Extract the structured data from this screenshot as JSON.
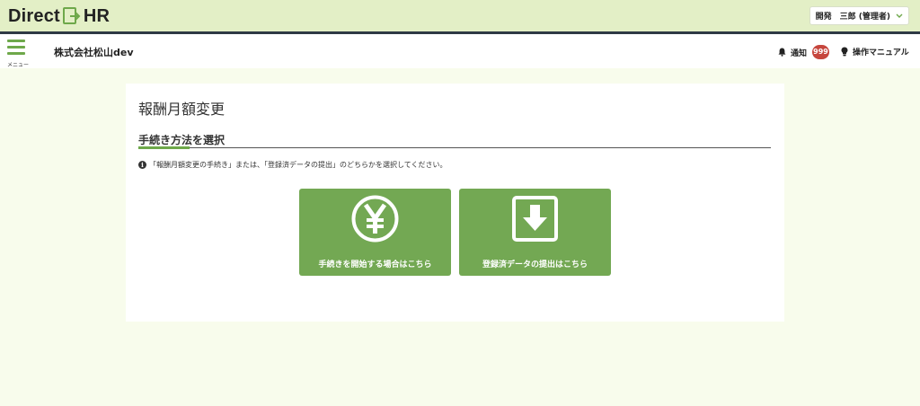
{
  "header": {
    "logo_left": "Direct",
    "logo_right": "HR",
    "user_name": "開発　三郎 (管理者)"
  },
  "nav": {
    "menu_label": "メニュー",
    "company": "株式会社松山dev",
    "notify_label": "通知",
    "notify_count": "999",
    "manual_label": "操作マニュアル"
  },
  "main": {
    "page_title": "報酬月額変更",
    "section_title": "手続き方法を選択",
    "info_text": "「報酬月額変更の手続き」または、「登録済データの提出」のどちらかを選択してください。",
    "actions": [
      {
        "label": "手続きを開始する場合はこちら",
        "icon": "yen-icon"
      },
      {
        "label": "登録済データの提出はこちら",
        "icon": "download-icon"
      }
    ]
  },
  "colors": {
    "accent": "#73a853",
    "topbar": "#e3efc6",
    "background": "#f8fcec",
    "badge": "#c6463d"
  }
}
